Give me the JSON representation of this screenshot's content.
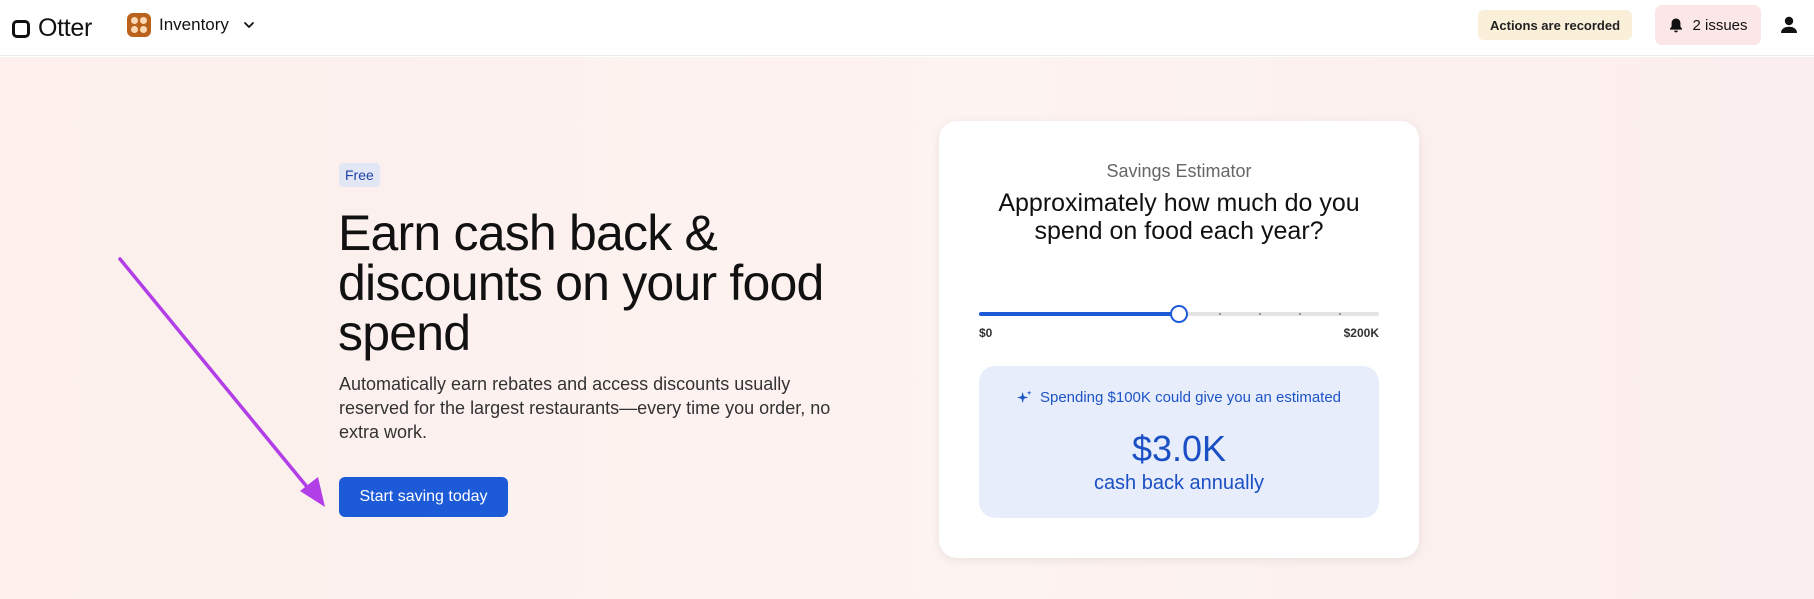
{
  "header": {
    "logo_text": "Otter",
    "app_name": "Inventory",
    "recording_badge": "Actions are recorded",
    "issues_label": "2 issues"
  },
  "hero": {
    "badge": "Free",
    "headline": "Earn cash back & discounts on your food spend",
    "description": "Automatically earn rebates and access discounts usually reserved for the largest restaurants—every time you order, no extra work.",
    "cta_label": "Start saving today"
  },
  "estimator": {
    "eyebrow": "Savings Estimator",
    "question": "Approximately how much do you spend on food each year?",
    "slider": {
      "min_label": "$0",
      "max_label": "$200K",
      "value_fraction": 0.5,
      "tick_count": 10
    },
    "result_line": "Spending $100K could give you an estimated",
    "result_value": "$3.0K",
    "result_caption": "cash back annually"
  },
  "colors": {
    "accent": "#1d5ad8",
    "annotation_arrow": "#b23ee8",
    "app_icon": "#b8621b"
  },
  "icons": [
    "otter-logo-icon",
    "inventory-app-icon",
    "chevron-down-icon",
    "bell-icon",
    "user-icon",
    "sparkle-icon",
    "annotation-arrow-icon"
  ]
}
